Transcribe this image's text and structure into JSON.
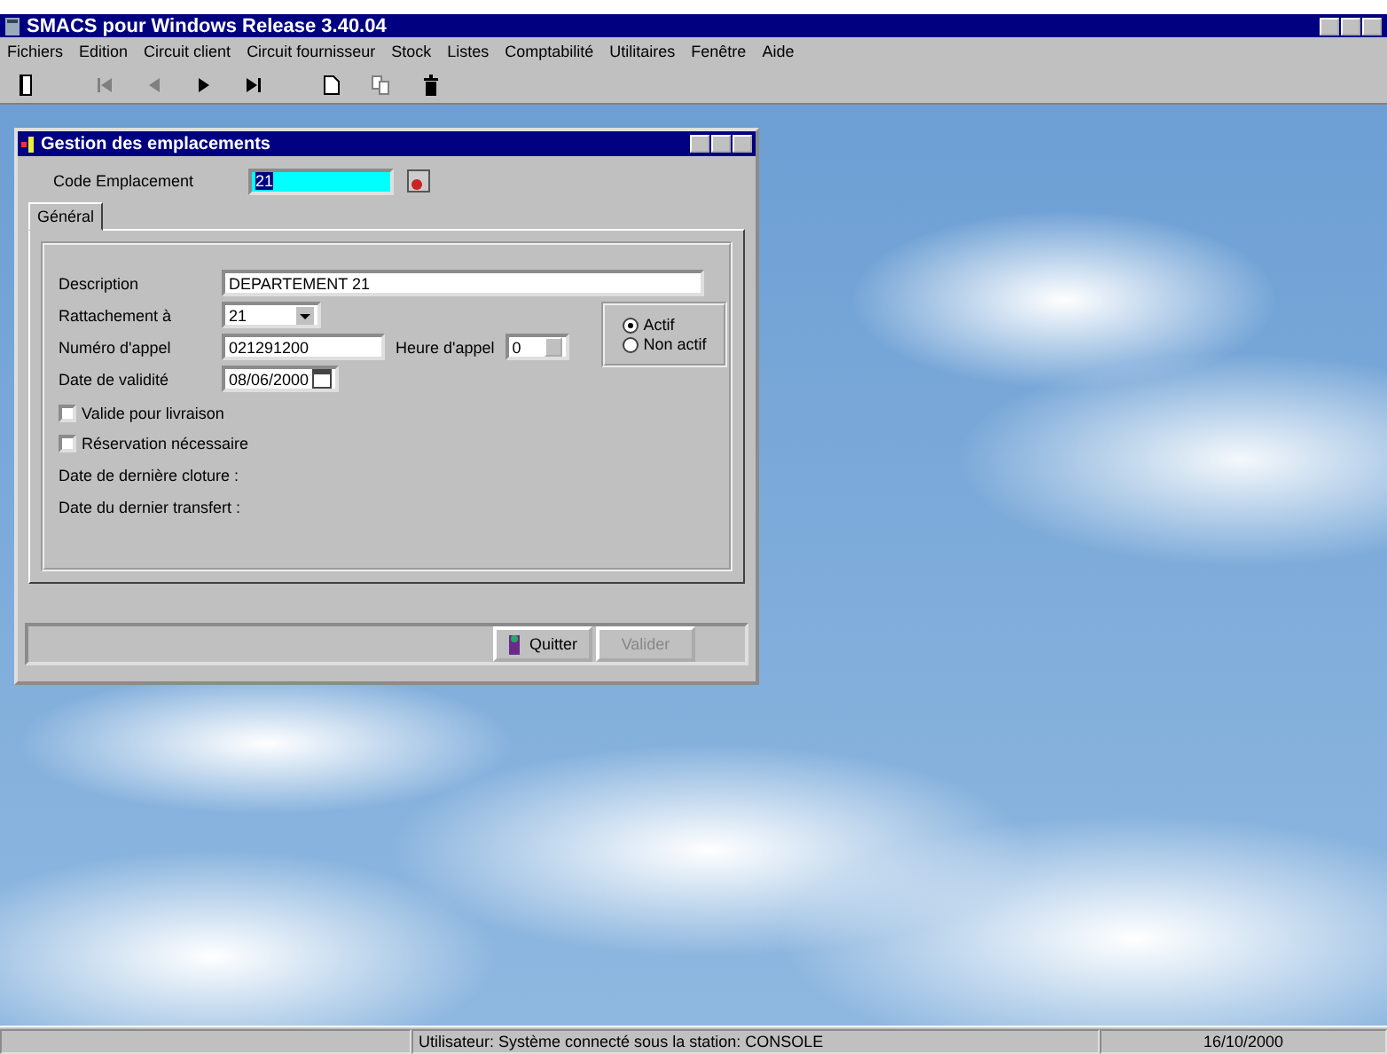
{
  "window": {
    "title": "SMACS pour Windows Release 3.40.04"
  },
  "menu": [
    {
      "label": "Fichiers",
      "disabled": false
    },
    {
      "label": "Edition",
      "disabled": false
    },
    {
      "label": "Circuit client",
      "disabled": false
    },
    {
      "label": "Circuit fournisseur",
      "disabled": false
    },
    {
      "label": "Stock",
      "disabled": false
    },
    {
      "label": "Listes",
      "disabled": false
    },
    {
      "label": "Comptabilité",
      "disabled": false
    },
    {
      "label": "Utilitaires",
      "disabled": false
    },
    {
      "label": "Fenêtre",
      "disabled": false
    },
    {
      "label": "Aide",
      "disabled": false
    }
  ],
  "toolbar": [
    {
      "kind": "door",
      "disabled": false
    },
    {
      "kind": "first",
      "disabled": true
    },
    {
      "kind": "prev",
      "disabled": true
    },
    {
      "kind": "next",
      "disabled": false
    },
    {
      "kind": "last",
      "disabled": false
    },
    {
      "kind": "new",
      "disabled": false
    },
    {
      "kind": "copy",
      "disabled": true
    },
    {
      "kind": "trash",
      "disabled": false
    }
  ],
  "dialog": {
    "title": "Gestion des emplacements",
    "code_label": "Code Emplacement",
    "code_value": "21",
    "tabs": [
      {
        "label": "Général",
        "selected": true
      }
    ],
    "description_label": "Description",
    "description": "DEPARTEMENT 21",
    "rattachement_label": "Rattachement à",
    "rattachement": "21",
    "numero_label": "Numéro d'appel",
    "numero": "021291200",
    "heure_label": "Heure d'appel",
    "heure": "0",
    "date_label": "Date de validité",
    "date": "08/06/2000",
    "status_options": [
      {
        "label": "Actif",
        "selected": true
      },
      {
        "label": "Non actif",
        "selected": false
      }
    ],
    "checkboxes": [
      {
        "label": "Valide pour livraison",
        "checked": false
      },
      {
        "label": "Réservation nécessaire",
        "checked": false
      }
    ],
    "info_lines": [
      "Date de dernière cloture :",
      "Date du dernier transfert :"
    ],
    "buttons": [
      {
        "label": "Quitter",
        "disabled": false
      },
      {
        "label": "Valider",
        "disabled": true
      }
    ]
  },
  "status_bar": {
    "message": "Utilisateur: Système connecté sous la station: CONSOLE",
    "date": "16/10/2000"
  }
}
